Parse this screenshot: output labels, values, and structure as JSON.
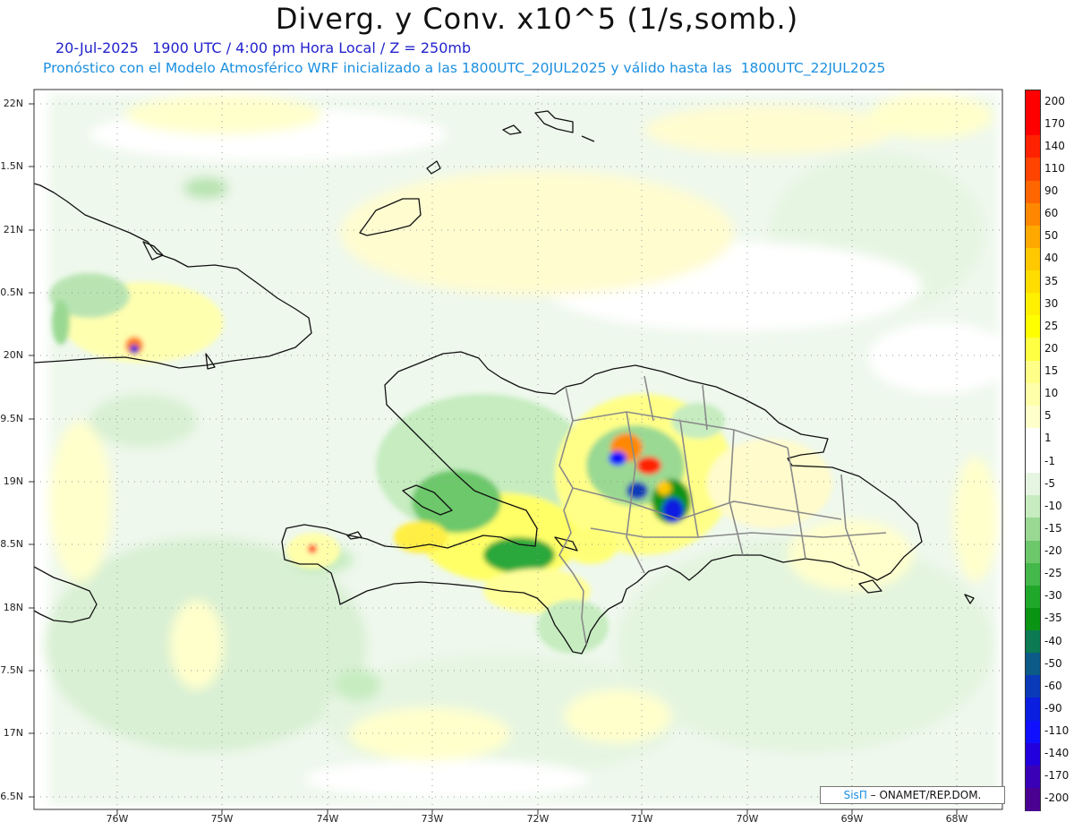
{
  "header": {
    "title": "Diverg. y Conv. x10^5 (1/s,somb.)",
    "date_line": "20-Jul-2025   1900 UTC / 4:00 pm Hora Local / Z = 250mb",
    "model_line": "Pronóstico con el Modelo Atmosférico WRF inicializado a las 1800UTC_20JUL2025 y válido hasta las  1800UTC_22JUL2025"
  },
  "map": {
    "lat_labels": [
      "22N",
      "1.5N",
      "21N",
      "0.5N",
      "20N",
      "9.5N",
      "19N",
      "8.5N",
      "18N",
      "7.5N",
      "17N",
      "6.5N"
    ],
    "lon_labels": [
      "76W",
      "75W",
      "74W",
      "73W",
      "72W",
      "71W",
      "70W",
      "69W",
      "68W"
    ]
  },
  "colorbar": {
    "labels": [
      "200",
      "170",
      "140",
      "110",
      "90",
      "60",
      "50",
      "40",
      "35",
      "30",
      "25",
      "20",
      "15",
      "10",
      "5",
      "1",
      "-1",
      "-5",
      "-10",
      "-15",
      "-20",
      "-25",
      "-30",
      "-35",
      "-40",
      "-50",
      "-60",
      "-90",
      "-110",
      "-140",
      "-170",
      "-200"
    ],
    "colors": [
      "#ff0000",
      "#ff0000",
      "#ff2200",
      "#ff4400",
      "#ff6600",
      "#ff8800",
      "#ffa800",
      "#ffc800",
      "#ffdd00",
      "#ffef00",
      "#ffff00",
      "#ffff44",
      "#ffff88",
      "#ffffaa",
      "#ffffcc",
      "#ffffff",
      "#ffffff",
      "#e6f5e2",
      "#c6ecc0",
      "#9ad993",
      "#6cc86a",
      "#44b84a",
      "#20a82a",
      "#0a9414",
      "#0c7a52",
      "#0c5a88",
      "#0a3ab8",
      "#0a1ee0",
      "#1010ff",
      "#2200dd",
      "#3a00b8",
      "#4a0090"
    ]
  },
  "credit": {
    "brand": "SisΠ",
    "text": " – ONAMET/REP.DOM."
  }
}
